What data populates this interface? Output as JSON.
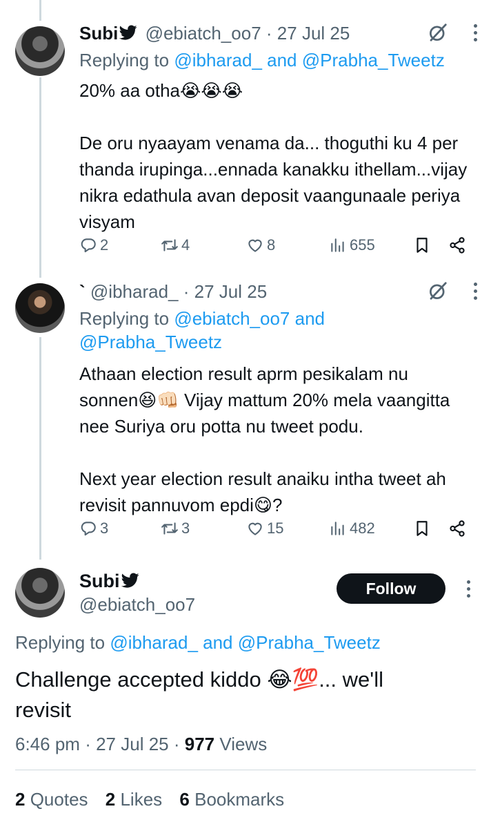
{
  "tweet1": {
    "name": "Subi",
    "handle": "@ebiatch_oo7",
    "sep": "·",
    "date": "27 Jul 25",
    "replying_prefix": "Replying to",
    "mention1": "@ibharad_",
    "and": "and",
    "mention2": "@Prabha_Tweetz",
    "text": "20% aa otha😭😭😭\n\nDe oru nyaayam venama da... thoguthi ku 4 per thanda irupinga...ennada kanakku ithellam...vijay nikra edathula avan deposit vaangunaale periya visyam",
    "replies": "2",
    "retweets": "4",
    "likes": "8",
    "views": "655"
  },
  "tweet2": {
    "name": "`",
    "handle": "@ibharad_",
    "sep": "·",
    "date": "27 Jul 25",
    "replying_prefix": "Replying to",
    "mention1": "@ebiatch_oo7",
    "and": "and",
    "mention2": "@Prabha_Tweetz",
    "text": "Athaan election result aprm pesikalam nu sonnen😆👊🏻 Vijay mattum 20% mela vaangitta nee Suriya oru potta nu tweet podu.\n\nNext year election result anaiku intha tweet ah revisit pannuvom epdi😋?",
    "replies": "3",
    "retweets": "3",
    "likes": "15",
    "views": "482"
  },
  "main": {
    "name": "Subi",
    "handle": "@ebiatch_oo7",
    "follow_label": "Follow",
    "replying_prefix": "Replying to",
    "mention1": "@ibharad_",
    "and": "and",
    "mention2": "@Prabha_Tweetz",
    "text": "Challenge accepted kiddo 😂💯... we'll revisit",
    "time": "6:46 pm",
    "sep": "·",
    "date": "27 Jul 25",
    "views_count": "977",
    "views_label": "Views",
    "quotes_count": "2",
    "quotes_label": "Quotes",
    "likes_count": "2",
    "likes_label": "Likes",
    "bookmarks_count": "6",
    "bookmarks_label": "Bookmarks"
  },
  "icons": [
    "bird-verified-icon",
    "grok-icon",
    "more-icon",
    "reply-icon",
    "retweet-icon",
    "like-icon",
    "views-icon",
    "bookmark-icon",
    "share-icon"
  ],
  "colors": {
    "link": "#1d9bf0",
    "muted": "#536471",
    "text": "#0f1419",
    "line": "#cfd9de"
  }
}
